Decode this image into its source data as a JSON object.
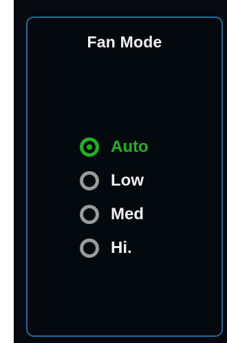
{
  "panel": {
    "title": "Fan Mode",
    "options": [
      {
        "label": "Auto",
        "selected": true
      },
      {
        "label": "Low",
        "selected": false
      },
      {
        "label": "Med",
        "selected": false
      },
      {
        "label": "Hi.",
        "selected": false
      }
    ]
  },
  "colors": {
    "accent": "#1fb41f",
    "border": "#1b6f9c",
    "background": "#04090d",
    "radio_unselected": "#9a9a9a",
    "text": "#f0f0f0"
  }
}
